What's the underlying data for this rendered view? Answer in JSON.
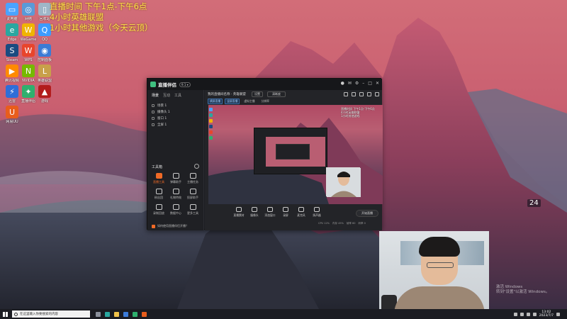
{
  "overlay": {
    "line1": "直播时间 下午1点-下午6点",
    "line2": "4小时英雄联盟",
    "line3": "1小时其他游戏（今天云顶）"
  },
  "desktop_icons": [
    {
      "label": "此电脑",
      "color": "#4aa3ff",
      "glyph": "▭"
    },
    {
      "label": "网络",
      "color": "#5a9ad8",
      "glyph": "◎"
    },
    {
      "label": "回收站",
      "color": "#9fb6c8",
      "glyph": "▯"
    },
    {
      "label": "Edge",
      "color": "#2aa7a0",
      "glyph": "e"
    },
    {
      "label": "WeGame",
      "color": "#f0b400",
      "glyph": "W"
    },
    {
      "label": "QQ",
      "color": "#3c9cff",
      "glyph": "Q"
    },
    {
      "label": "Steam",
      "color": "#1b4b80",
      "glyph": "S"
    },
    {
      "label": "WPS",
      "color": "#e8452c",
      "glyph": "W"
    },
    {
      "label": "控制面板",
      "color": "#3a7bd5",
      "glyph": "◉"
    },
    {
      "label": "腾讯视频",
      "color": "#ff8a00",
      "glyph": "▶"
    },
    {
      "label": "NVIDIA",
      "color": "#76b900",
      "glyph": "N"
    },
    {
      "label": "英雄联盟",
      "color": "#c8a04a",
      "glyph": "L"
    },
    {
      "label": "迅雷",
      "color": "#2f6ed8",
      "glyph": "⚡"
    },
    {
      "label": "直播伴侣",
      "color": "#2fb06e",
      "glyph": "✦"
    },
    {
      "label": "游戏",
      "color": "#b21c1c",
      "glyph": "▲"
    },
    {
      "label": "网易UU",
      "color": "#e85d1c",
      "glyph": "U"
    }
  ],
  "app": {
    "title": "直播伴侣",
    "badge": "9.1 ▾",
    "left_tabs": [
      "场景",
      "互动",
      "工具"
    ],
    "scenes": [
      "场景 1",
      "摄像头 1",
      "窗口 1",
      "全屏 1"
    ],
    "tools_heading": "工具箱",
    "tools": [
      "直播工具",
      "弹幕助手",
      "主播任务",
      "粉丝团",
      "礼物特效",
      "投屏助手",
      "录制回放",
      "数据中心",
      "更多工具"
    ],
    "footer": "如何使用直播伴侣开播？",
    "main_title": "我的直播间名称 · 英雄联盟",
    "main_btn1": "设置",
    "main_btn2": "清晰度",
    "chips": [
      "横屏直播",
      "竖屏直播",
      "虚拟主播",
      "分辨率"
    ],
    "preview_overlay_1": "直播时间 下午1点-下午6点",
    "preview_overlay_2": "4小时英雄联盟",
    "preview_overlay_3": "1小时其他游戏",
    "toolbar": [
      "直播素材",
      "摄像头",
      "添加窗口",
      "录屏",
      "麦克风",
      "扬声器"
    ],
    "start_label": "开始直播",
    "status": [
      "CPU 12%",
      "内存 45%",
      "帧率 60",
      "码率 0"
    ]
  },
  "right_badge": "24",
  "activate": {
    "line1": "激活 Windows",
    "line2": "转到\"设置\"以激活 Windows。"
  },
  "taskbar": {
    "search_placeholder": "在这里输入你要搜索的内容",
    "time": "13:02",
    "date": "2023/7/7"
  }
}
